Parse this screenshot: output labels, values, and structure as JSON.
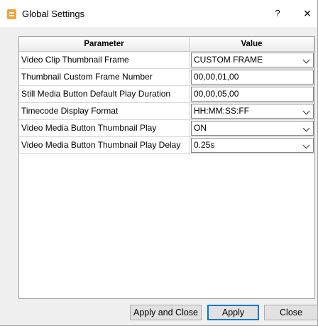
{
  "window": {
    "title": "Global Settings",
    "help_label": "?",
    "close_label": "×"
  },
  "table": {
    "headers": [
      "Parameter",
      "Value"
    ],
    "rows": [
      {
        "parameter": "Video Clip Thumbnail Frame",
        "value": "CUSTOM FRAME",
        "control": "dropdown"
      },
      {
        "parameter": "Thumbnail Custom Frame Number",
        "value": "00,00,01,00",
        "control": "textbox"
      },
      {
        "parameter": "Still Media Button Default Play Duration",
        "value": "00,00,05,00",
        "control": "textbox"
      },
      {
        "parameter": "Timecode Display Format",
        "value": "HH:MM:SS:FF",
        "control": "dropdown"
      },
      {
        "parameter": "Video Media Button Thumbnail Play",
        "value": "ON",
        "control": "dropdown"
      },
      {
        "parameter": "Video Media Button Thumbnail Play Delay",
        "value": "0.25s",
        "control": "dropdown"
      }
    ]
  },
  "buttons": {
    "apply_and_close": "Apply and Close",
    "apply": "Apply",
    "close": "Close"
  },
  "colors": {
    "app_icon": "#f5a33a",
    "focus_border": "#0078d7",
    "dialog_bg": "#f0f0f0"
  }
}
